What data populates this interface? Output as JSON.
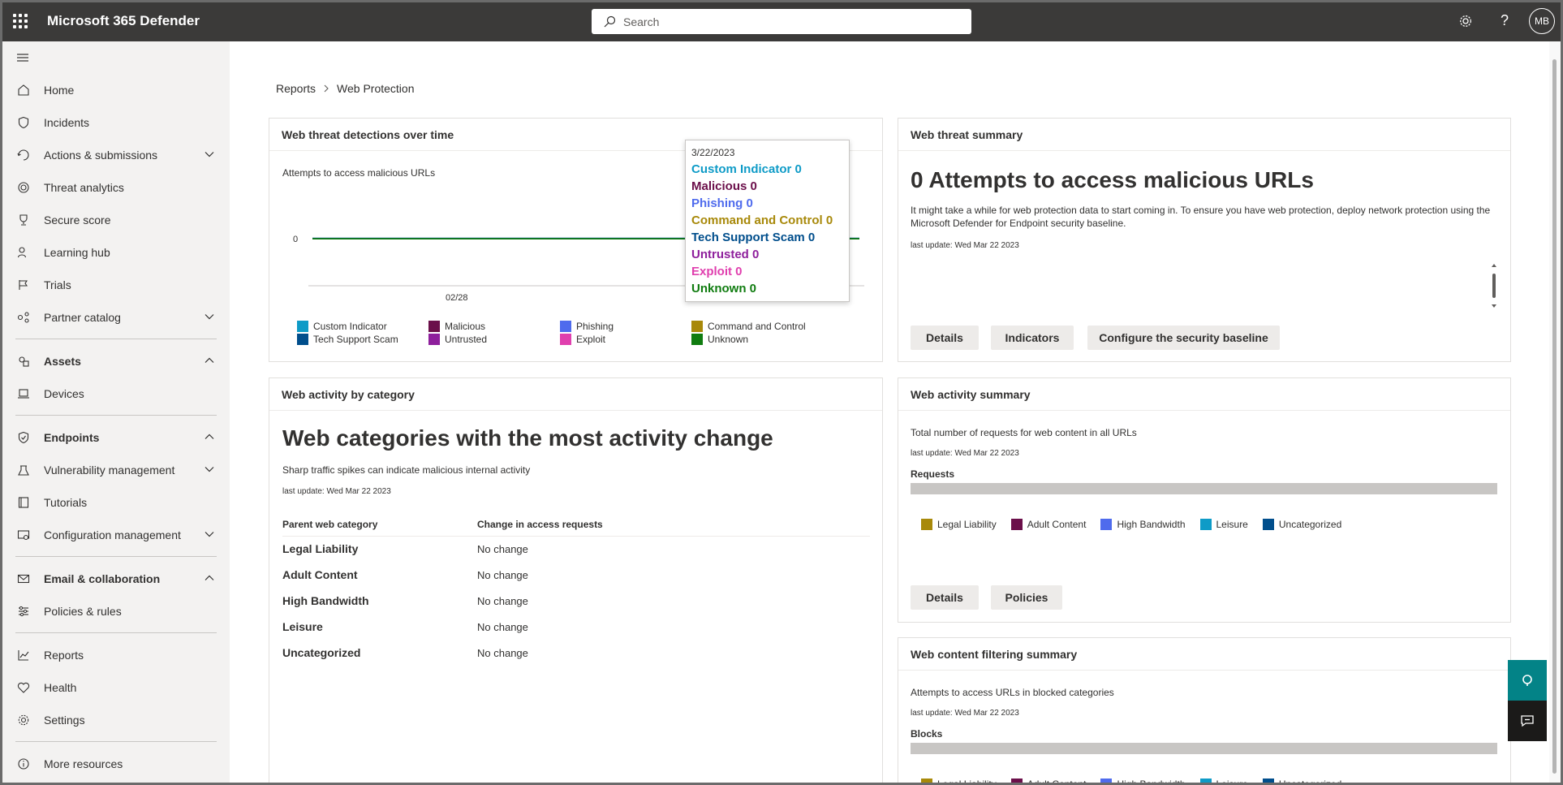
{
  "app": {
    "title": "Microsoft 365 Defender",
    "search_placeholder": "Search",
    "avatar_initials": "MB"
  },
  "sidebar": {
    "items": [
      {
        "label": "Home"
      },
      {
        "label": "Incidents"
      },
      {
        "label": "Actions & submissions"
      },
      {
        "label": "Threat analytics"
      },
      {
        "label": "Secure score"
      },
      {
        "label": "Learning hub"
      },
      {
        "label": "Trials"
      },
      {
        "label": "Partner catalog"
      },
      {
        "label": "Assets"
      },
      {
        "label": "Devices"
      },
      {
        "label": "Endpoints"
      },
      {
        "label": "Vulnerability management"
      },
      {
        "label": "Tutorials"
      },
      {
        "label": "Configuration management"
      },
      {
        "label": "Email & collaboration"
      },
      {
        "label": "Policies & rules"
      },
      {
        "label": "Reports"
      },
      {
        "label": "Health"
      },
      {
        "label": "Settings"
      },
      {
        "label": "More resources"
      }
    ]
  },
  "breadcrumb": {
    "parent": "Reports",
    "current": "Web Protection"
  },
  "detections": {
    "title": "Web threat detections over time",
    "subtitle": "Attempts to access malicious URLs",
    "y_tick": "0",
    "x_tick": "02/28",
    "legend": [
      {
        "label": "Custom Indicator",
        "color": "#0e9bc7"
      },
      {
        "label": "Malicious",
        "color": "#6b0f4a"
      },
      {
        "label": "Phishing",
        "color": "#4f6bed"
      },
      {
        "label": "Command and Control",
        "color": "#a8890a"
      },
      {
        "label": "Tech Support Scam",
        "color": "#004e8c"
      },
      {
        "label": "Untrusted",
        "color": "#8e1f9c"
      },
      {
        "label": "Exploit",
        "color": "#e03fae"
      },
      {
        "label": "Unknown",
        "color": "#107c10"
      }
    ],
    "tooltip": {
      "date": "3/22/2023",
      "rows": [
        {
          "text": "Custom Indicator 0",
          "color": "#0e9bc7"
        },
        {
          "text": "Malicious 0",
          "color": "#6b0f4a"
        },
        {
          "text": "Phishing 0",
          "color": "#4f6bed"
        },
        {
          "text": "Command and Control 0",
          "color": "#a8890a"
        },
        {
          "text": "Tech Support Scam 0",
          "color": "#004e8c"
        },
        {
          "text": "Untrusted 0",
          "color": "#8e1f9c"
        },
        {
          "text": "Exploit 0",
          "color": "#e03fae"
        },
        {
          "text": "Unknown 0",
          "color": "#107c10"
        }
      ]
    }
  },
  "threat_summary": {
    "title": "Web threat summary",
    "headline": "0 Attempts to access malicious URLs",
    "description": "It might take a while for web protection data to start coming in. To ensure you have web protection, deploy network protection using the Microsoft Defender for Endpoint security baseline.",
    "last_update": "last update: Wed Mar 22 2023",
    "buttons": {
      "details": "Details",
      "indicators": "Indicators",
      "configure": "Configure the security baseline"
    }
  },
  "activity_category": {
    "title": "Web activity by category",
    "headline": "Web categories with the most activity change",
    "description": "Sharp traffic spikes can indicate malicious internal activity",
    "last_update": "last update: Wed Mar 22 2023",
    "columns": [
      "Parent web category",
      "Change in access requests"
    ],
    "rows": [
      {
        "category": "Legal Liability",
        "change": "No change"
      },
      {
        "category": "Adult Content",
        "change": "No change"
      },
      {
        "category": "High Bandwidth",
        "change": "No change"
      },
      {
        "category": "Leisure",
        "change": "No change"
      },
      {
        "category": "Uncategorized",
        "change": "No change"
      }
    ]
  },
  "activity_summary": {
    "title": "Web activity summary",
    "description": "Total number of requests for web content in all URLs",
    "last_update": "last update: Wed Mar 22 2023",
    "bar_label": "Requests",
    "legend": [
      {
        "label": "Legal Liability",
        "color": "#a8890a"
      },
      {
        "label": "Adult Content",
        "color": "#6b0f4a"
      },
      {
        "label": "High Bandwidth",
        "color": "#4f6bed"
      },
      {
        "label": "Leisure",
        "color": "#0e9bc7"
      },
      {
        "label": "Uncategorized",
        "color": "#004e8c"
      }
    ],
    "buttons": {
      "details": "Details",
      "policies": "Policies"
    }
  },
  "filtering_summary": {
    "title": "Web content filtering summary",
    "description": "Attempts to access URLs in blocked categories",
    "last_update": "last update: Wed Mar 22 2023",
    "bar_label": "Blocks",
    "legend": [
      {
        "label": "Legal Liability",
        "color": "#a8890a"
      },
      {
        "label": "Adult Content",
        "color": "#6b0f4a"
      },
      {
        "label": "High Bandwidth",
        "color": "#4f6bed"
      },
      {
        "label": "Leisure",
        "color": "#0e9bc7"
      },
      {
        "label": "Uncategorized",
        "color": "#004e8c"
      }
    ]
  }
}
